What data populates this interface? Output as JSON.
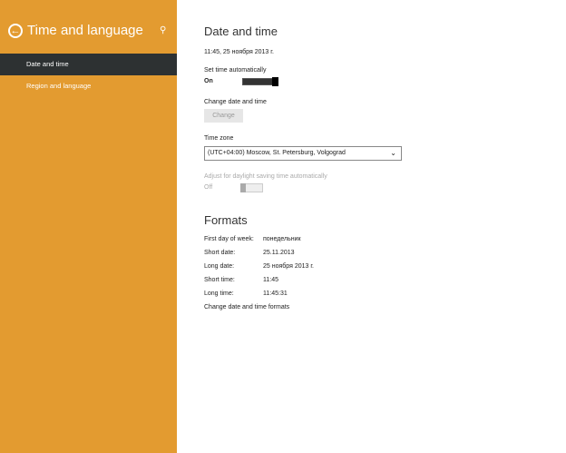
{
  "sidebar": {
    "title": "Time and language",
    "items": [
      {
        "label": "Date and time",
        "selected": true
      },
      {
        "label": "Region and language"
      }
    ]
  },
  "date_time": {
    "heading": "Date and time",
    "current": "11:45, 25 ноября 2013 г.",
    "set_auto_label": "Set time automatically",
    "set_auto_state": "On",
    "change_label": "Change date and time",
    "change_button": "Change",
    "timezone_label": "Time zone",
    "timezone_value": "(UTC+04:00) Moscow, St. Petersburg, Volgograd",
    "dst_label": "Adjust for daylight saving time automatically",
    "dst_state": "Off"
  },
  "formats": {
    "heading": "Formats",
    "rows": [
      {
        "label": "First day of week:",
        "value": "понедельник"
      },
      {
        "label": "Short date:",
        "value": "25.11.2013"
      },
      {
        "label": "Long date:",
        "value": "25 ноября 2013 г."
      },
      {
        "label": "Short time:",
        "value": "11:45"
      },
      {
        "label": "Long time:",
        "value": "11:45:31"
      }
    ],
    "link": "Change date and time formats"
  },
  "colors": {
    "accent": "#e39b30",
    "selected": "#2d3132"
  }
}
